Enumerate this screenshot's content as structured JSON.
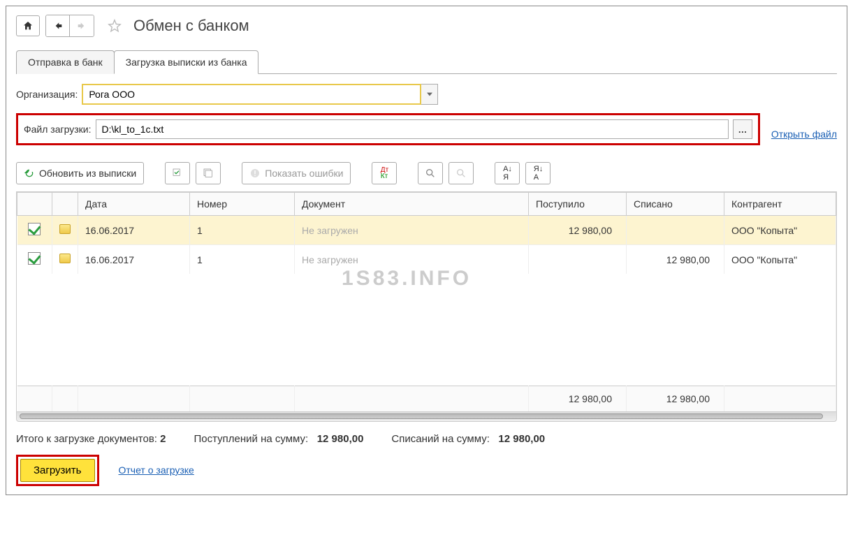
{
  "header": {
    "title": "Обмен с банком"
  },
  "tabs": {
    "send": "Отправка в банк",
    "load": "Загрузка выписки из банка"
  },
  "form": {
    "org_label": "Организация:",
    "org_value": "Рога ООО",
    "file_label": "Файл загрузки:",
    "file_value": "D:\\kl_to_1c.txt",
    "open_file": "Открыть файл"
  },
  "toolbar": {
    "refresh": "Обновить из выписки",
    "errors": "Показать ошибки"
  },
  "columns": {
    "date": "Дата",
    "number": "Номер",
    "document": "Документ",
    "received": "Поступило",
    "debited": "Списано",
    "contractor": "Контрагент"
  },
  "rows": [
    {
      "date": "16.06.2017",
      "number": "1",
      "document": "Не загружен",
      "received": "12 980,00",
      "debited": "",
      "contractor": "ООО \"Копыта\""
    },
    {
      "date": "16.06.2017",
      "number": "1",
      "document": "Не загружен",
      "received": "",
      "debited": "12 980,00",
      "contractor": "ООО \"Копыта\""
    }
  ],
  "totals": {
    "received": "12 980,00",
    "debited": "12 980,00"
  },
  "summary": {
    "docs_label": "Итого к загрузке документов:",
    "docs_value": "2",
    "in_label": "Поступлений на сумму:",
    "in_value": "12 980,00",
    "out_label": "Списаний на сумму:",
    "out_value": "12 980,00"
  },
  "footer": {
    "load": "Загрузить",
    "report": "Отчет о загрузке"
  },
  "watermark": "1S83.INFO"
}
